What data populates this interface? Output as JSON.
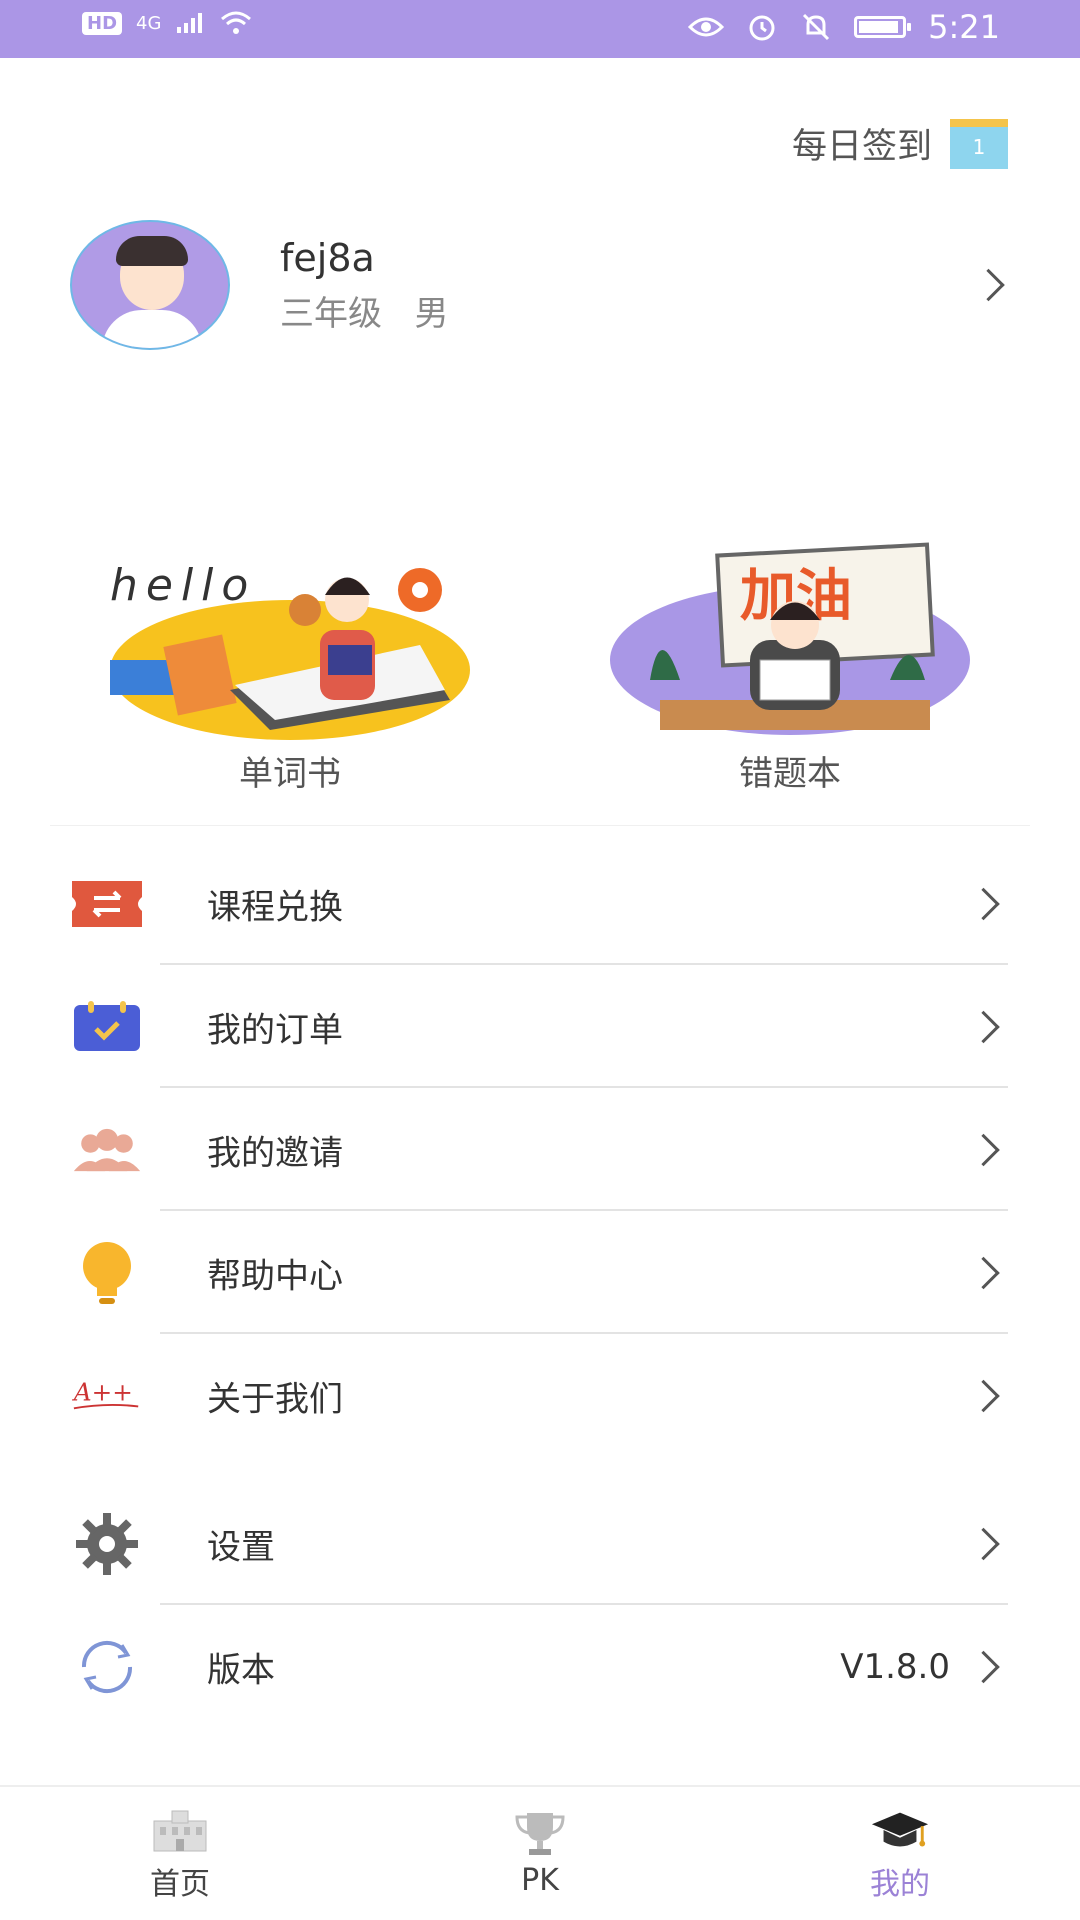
{
  "status_bar": {
    "hd": "HD",
    "signal": "4G",
    "time": "5:21"
  },
  "checkin": {
    "label": "每日签到",
    "calendar_day": "1"
  },
  "profile": {
    "username": "fej8a",
    "grade": "三年级",
    "gender": "男"
  },
  "cards": [
    {
      "label": "单词书",
      "illustration_text": "hello"
    },
    {
      "label": "错题本",
      "illustration_text": "加油"
    }
  ],
  "menu_group1": [
    {
      "label": "课程兑换",
      "icon": "exchange-ticket-icon"
    },
    {
      "label": "我的订单",
      "icon": "order-calendar-icon"
    },
    {
      "label": "我的邀请",
      "icon": "people-icon"
    },
    {
      "label": "帮助中心",
      "icon": "lightbulb-icon"
    },
    {
      "label": "关于我们",
      "icon": "a-plus-icon",
      "icon_text": "A++"
    }
  ],
  "menu_group2": [
    {
      "label": "设置",
      "icon": "gear-icon"
    },
    {
      "label": "版本",
      "icon": "refresh-icon",
      "value": "V1.8.0"
    }
  ],
  "bottom_nav": [
    {
      "label": "首页",
      "icon": "home-icon",
      "active": false
    },
    {
      "label": "PK",
      "icon": "trophy-icon",
      "active": false
    },
    {
      "label": "我的",
      "icon": "graduation-cap-icon",
      "active": true
    }
  ],
  "colors": {
    "status_bar": "#ab96e6",
    "accent": "#9b82d6"
  }
}
